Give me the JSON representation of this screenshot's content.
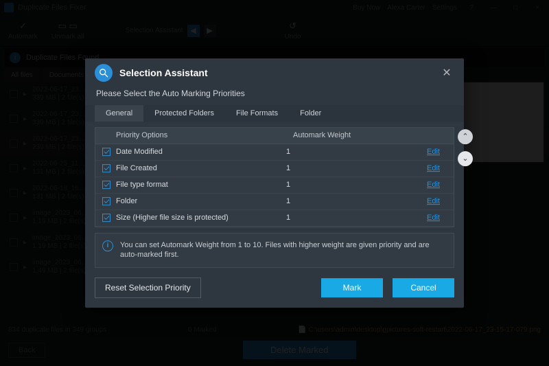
{
  "app": {
    "title": "Duplicate Files Fixer",
    "title_right": [
      "Buy Now",
      "Alexa Carter",
      "Settings",
      "?",
      "—",
      "□",
      "×"
    ],
    "toolbar": {
      "automark": "Automark",
      "unmark": "Unmark all",
      "sa": "Selection Assistant",
      "undo": "Undo"
    },
    "banner": "Duplicate Files Found",
    "tabs": [
      "All files",
      "Documents"
    ],
    "rows": [
      {
        "name": "2022-06-17_23…",
        "meta": "339 MB | 2 file(s)"
      },
      {
        "name": "2022-06-17_23…",
        "meta": "339 MB | 2 file(s)"
      },
      {
        "name": "2022-06-17_23…",
        "meta": "239 MB | 2 file(s)"
      },
      {
        "name": "2022-06-25_11…",
        "meta": "131 MB | 2 file(s)"
      },
      {
        "name": "2022-06-18_16…",
        "meta": "131 MB | 2 file(s)"
      },
      {
        "name": "image_2023_06…",
        "meta": "1.19 MB | 2 file(s)"
      },
      {
        "name": "image_2023_06…",
        "meta": "1.19 MB | 2 file(s)"
      },
      {
        "name": "image_2023_06…",
        "meta": "1.49 MB | 2 file(s)"
      }
    ],
    "footer": {
      "summary": "834 duplicate files in 349 groups",
      "marked": "0 Marked",
      "path": "C:\\users\\admin\\desktop\\gpictures-soft-restart\\2022-06-17_23-15-17-079.png",
      "back": "Back",
      "delete": "Delete Marked"
    }
  },
  "modal": {
    "title": "Selection Assistant",
    "subtitle": "Please Select the Auto Marking Priorities",
    "tabs": [
      "General",
      "Protected Folders",
      "File Formats",
      "Folder"
    ],
    "active_tab": 0,
    "col_opt": "Priority Options",
    "col_weight": "Automark Weight",
    "rows": [
      {
        "label": "Date Modified",
        "weight": "1",
        "edit": "Edit"
      },
      {
        "label": "File Created",
        "weight": "1",
        "edit": "Edit"
      },
      {
        "label": "File type format",
        "weight": "1",
        "edit": "Edit"
      },
      {
        "label": "Folder",
        "weight": "1",
        "edit": "Edit"
      },
      {
        "label": "Size (Higher file size is protected)",
        "weight": "1",
        "edit": "Edit"
      }
    ],
    "info": "You can set Automark Weight from 1 to 10. Files with higher weight are given priority and are auto-marked first.",
    "reset": "Reset Selection Priority",
    "mark": "Mark",
    "cancel": "Cancel"
  }
}
